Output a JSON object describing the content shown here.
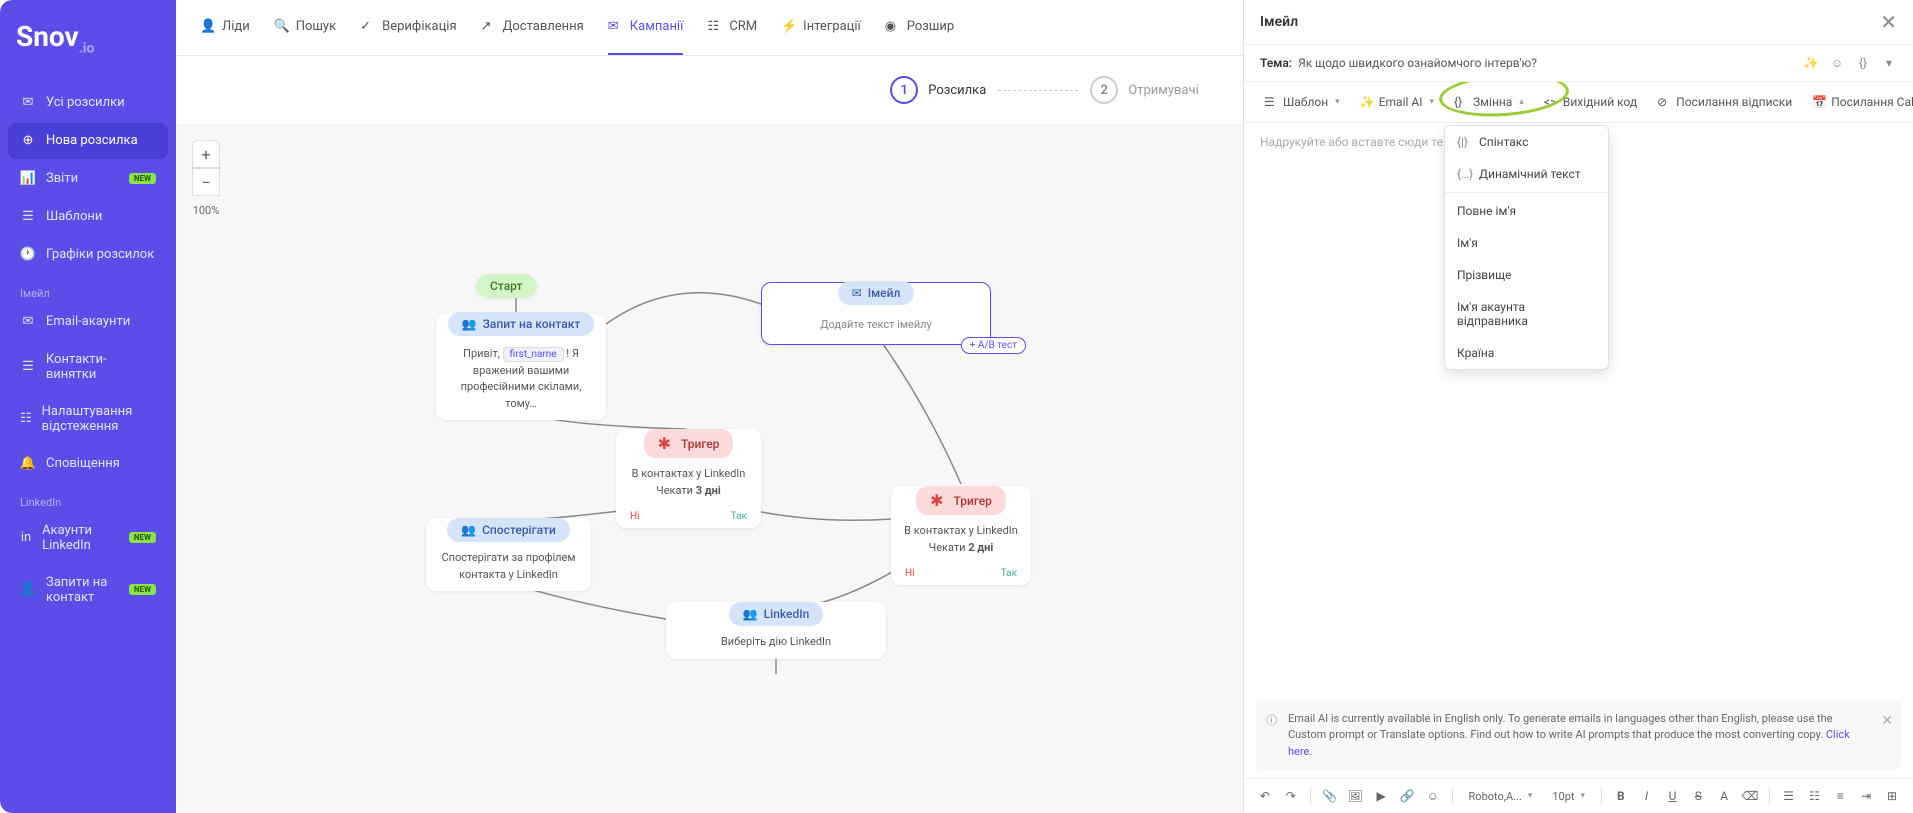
{
  "logo": {
    "main": "Snov",
    "suffix": ".io"
  },
  "sidebar": {
    "items": [
      {
        "label": "Усі розсилки"
      },
      {
        "label": "Нова розсилка"
      },
      {
        "label": "Звіти",
        "new": "NEW"
      },
      {
        "label": "Шаблони"
      },
      {
        "label": "Графіки розсилок"
      }
    ],
    "group_email": "Імейл",
    "email_items": [
      {
        "label": "Email-акаунти"
      },
      {
        "label": "Контакти-винятки"
      },
      {
        "label": "Налаштування відстеження"
      },
      {
        "label": "Сповіщення"
      }
    ],
    "group_linkedin": "LinkedIn",
    "linkedin_items": [
      {
        "label": "Акаунти LinkedIn",
        "new": "NEW"
      },
      {
        "label": "Запити на контакт",
        "new": "NEW"
      }
    ]
  },
  "topnav": {
    "items": [
      {
        "label": "Ліди"
      },
      {
        "label": "Пошук"
      },
      {
        "label": "Верифікація"
      },
      {
        "label": "Доставлення"
      },
      {
        "label": "Кампанії"
      },
      {
        "label": "CRM"
      },
      {
        "label": "Інтеграції"
      },
      {
        "label": "Розшир"
      }
    ]
  },
  "steps": {
    "s1": {
      "num": "1",
      "label": "Розсилка"
    },
    "s2": {
      "num": "2",
      "label": "Отримувачі"
    }
  },
  "zoom": {
    "level": "100%"
  },
  "nodes": {
    "start": "Старт",
    "contact": {
      "title": "Запит на контакт",
      "text_pre": "Привіт, ",
      "var": "first_name",
      "text_post": " ! Я вражений вашими професійними скілами, тому…"
    },
    "email": {
      "title": "Імейл",
      "text": "Додайте текст імейлу",
      "ab": "+ A/B тест"
    },
    "trigger1": {
      "title": "Тригер",
      "line1": "В контактах у LinkedIn",
      "line2_pre": "Чекати ",
      "line2_b": "3 дні",
      "no": "Ні",
      "yes": "Так"
    },
    "watch": {
      "title": "Спостерігати",
      "text": "Спостерігати за профілем контакта у LinkedIn"
    },
    "trigger2": {
      "title": "Тригер",
      "line1": "В контактах у LinkedIn",
      "line2_pre": "Чекати ",
      "line2_b": "2 дні",
      "no": "Ні",
      "yes": "Так"
    },
    "linkedin": {
      "title": "LinkedIn",
      "text": "Виберіть дію LinkedIn"
    }
  },
  "panel": {
    "title": "Імейл",
    "subject_label": "Тема:",
    "subject_value": "Як щодо швидкого ознайомчого інтерв'ю?",
    "toolbar": {
      "template": "Шаблон",
      "emailai": "Email AI",
      "variable": "Змінна",
      "source": "Вихідний код",
      "unsubscribe": "Посилання відписки",
      "calendly": "Посилання Calendly"
    },
    "placeholder": "Надрукуйте або вставте сюди текст",
    "dropdown": {
      "spintax": "Спінтакс",
      "dynamic": "Динамічний текст",
      "fullname": "Повне ім'я",
      "firstname": "Ім'я",
      "lastname": "Прізвище",
      "sender": "Ім'я акаунта відправника",
      "country": "Країна"
    },
    "notice": {
      "text": "Email AI is currently available in English only. To generate emails in languages other than English, please use the Custom prompt or Translate options. Find out how to write AI prompts that produce the most converting copy. ",
      "link": "Click here"
    },
    "editor_toolbar": {
      "font": "Roboto,A...",
      "size": "10pt"
    }
  }
}
